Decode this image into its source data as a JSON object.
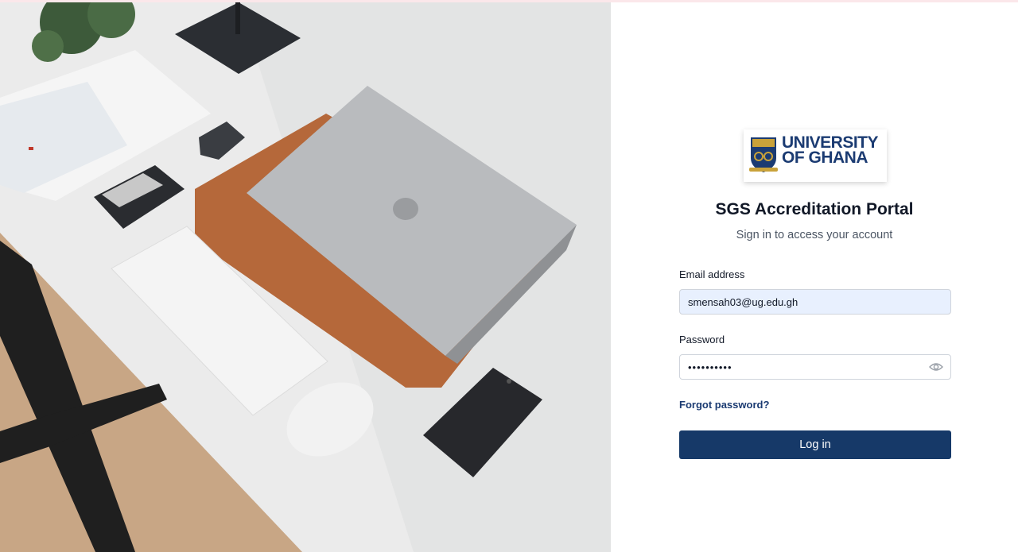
{
  "hero": {
    "image_alt": "desk-with-laptop-photo"
  },
  "logo": {
    "line1": "UNIVERSITY",
    "line2": "OF GHANA",
    "brand_color": "#1b3b72"
  },
  "header": {
    "title": "SGS Accreditation Portal",
    "subtitle": "Sign in to access your account"
  },
  "form": {
    "email_label": "Email address",
    "email_value": "smensah03@ug.edu.gh",
    "password_label": "Password",
    "password_masked": "••••••••••",
    "password_toggle_icon": "eye-icon",
    "forgot_label": "Forgot password?",
    "login_label": "Log in",
    "button_color": "#163968",
    "autofill_color": "#e8f0fe"
  }
}
